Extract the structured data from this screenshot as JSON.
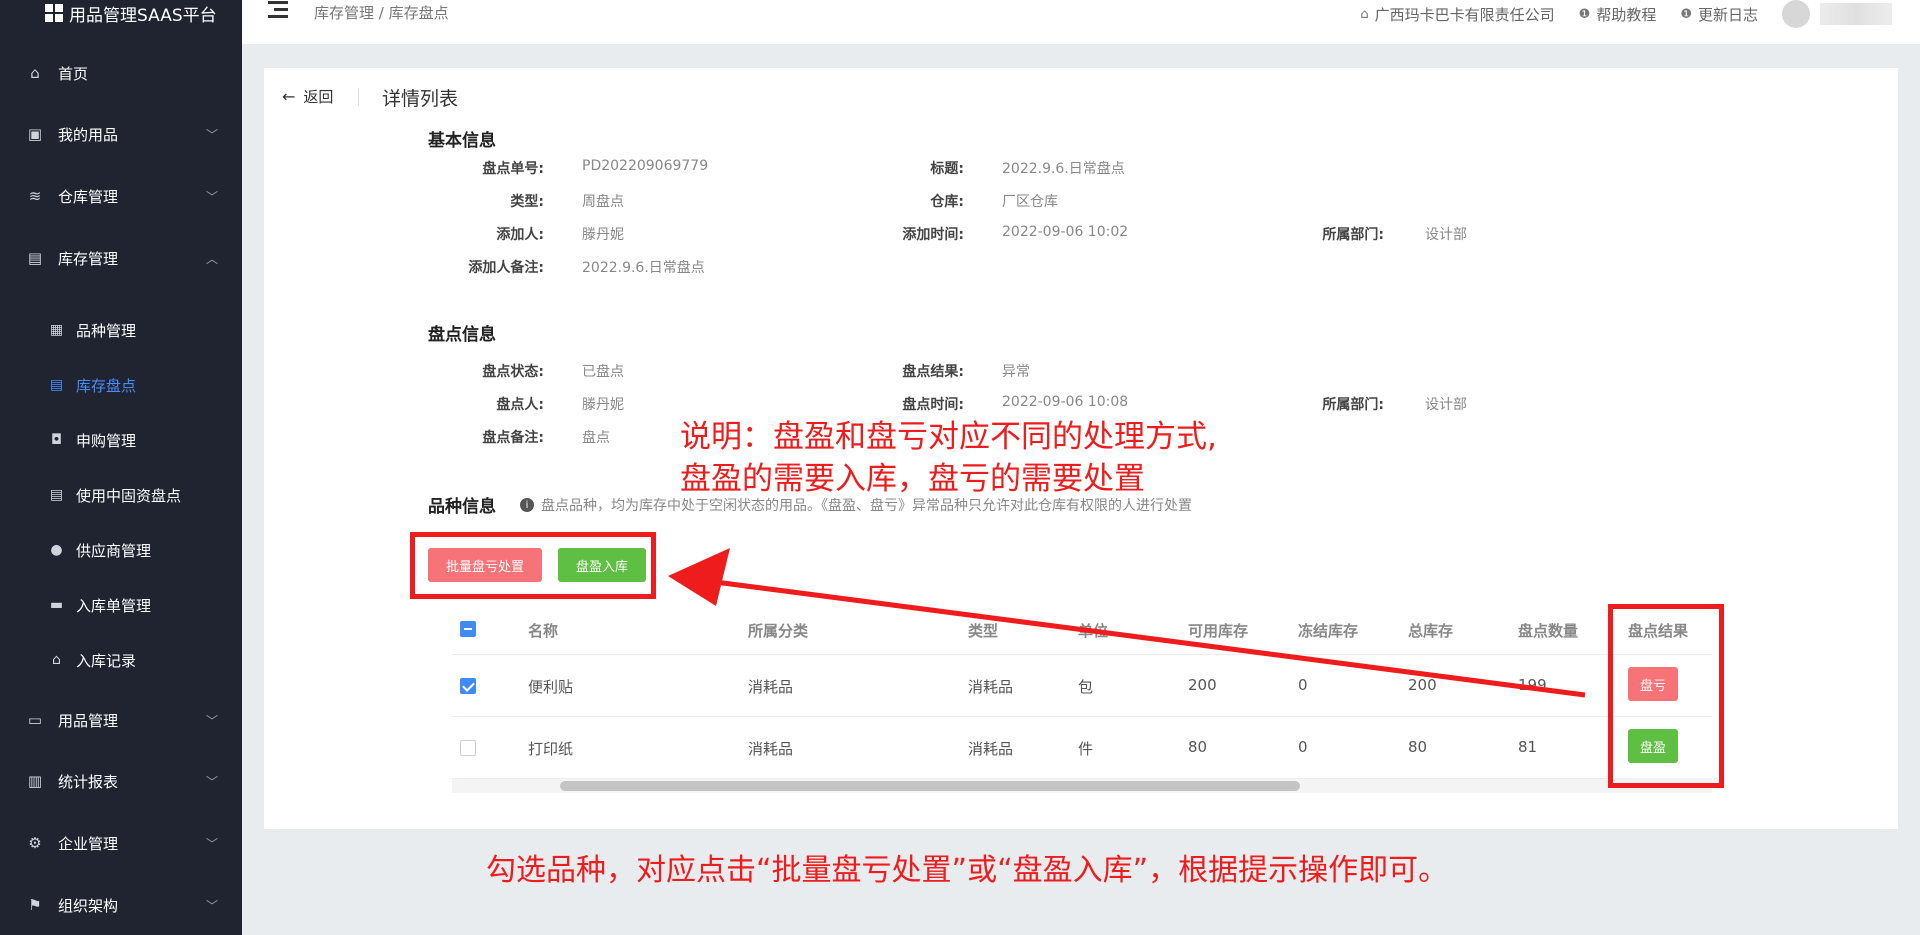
{
  "app": {
    "title": "用品管理SAAS平台"
  },
  "sidebar": {
    "items": [
      {
        "label": "首页",
        "icon": "home-icon"
      },
      {
        "label": "我的用品",
        "icon": "package-icon",
        "chevron": "down"
      },
      {
        "label": "仓库管理",
        "icon": "database-icon",
        "chevron": "down"
      },
      {
        "label": "库存管理",
        "icon": "briefcase-icon",
        "chevron": "up"
      },
      {
        "label": "用品管理",
        "icon": "inbox-icon",
        "chevron": "down"
      },
      {
        "label": "统计报表",
        "icon": "bar-chart-icon",
        "chevron": "down"
      },
      {
        "label": "企业管理",
        "icon": "gear-icon",
        "chevron": "down"
      },
      {
        "label": "组织架构",
        "icon": "flag-icon",
        "chevron": "down"
      }
    ],
    "sub_items": [
      {
        "label": "品种管理",
        "icon": "grid-icon"
      },
      {
        "label": "库存盘点",
        "icon": "document-icon",
        "active": true
      },
      {
        "label": "申购管理",
        "icon": "bag-icon"
      },
      {
        "label": "使用中固资盘点",
        "icon": "document-icon"
      },
      {
        "label": "供应商管理",
        "icon": "user-icon"
      },
      {
        "label": "入库单管理",
        "icon": "tray-icon"
      },
      {
        "label": "入库记录",
        "icon": "home-icon"
      }
    ]
  },
  "header": {
    "breadcrumb": "库存管理 / 库存盘点",
    "company": "广西玛卡巴卡有限责任公司",
    "help": "帮助教程",
    "changelog": "更新日志"
  },
  "page": {
    "back_label": "返回",
    "title": "详情列表"
  },
  "basic_info": {
    "title": "基本信息",
    "order_no_label": "盘点单号:",
    "order_no": "PD202209069779",
    "subject_label": "标题:",
    "subject": "2022.9.6.日常盘点",
    "type_label": "类型:",
    "type": "周盘点",
    "warehouse_label": "仓库:",
    "warehouse": "厂区仓库",
    "adder_label": "添加人:",
    "adder": "滕丹妮",
    "add_time_label": "添加时间:",
    "add_time": "2022-09-06 10:02",
    "dept_label": "所属部门:",
    "dept": "设计部",
    "remark_label": "添加人备注:",
    "remark": "2022.9.6.日常盘点"
  },
  "check_info": {
    "title": "盘点信息",
    "status_label": "盘点状态:",
    "status": "已盘点",
    "result_label": "盘点结果:",
    "result": "异常",
    "checker_label": "盘点人:",
    "checker": "滕丹妮",
    "check_time_label": "盘点时间:",
    "check_time": "2022-09-06 10:08",
    "dept_label": "所属部门:",
    "dept": "设计部",
    "remark_label": "盘点备注:",
    "remark": "盘点"
  },
  "items_info": {
    "title": "品种信息",
    "hint": "盘点品种，均为库存中处于空闲状态的用品。《盘盈、盘亏》异常品种只允许对此仓库有权限的人进行处置",
    "batch_loss_button": "批量盘亏处置",
    "gain_in_button": "盘盈入库"
  },
  "table": {
    "headers": [
      "名称",
      "所属分类",
      "类型",
      "单位",
      "可用库存",
      "冻结库存",
      "总库存",
      "盘点数量",
      "盘点结果"
    ],
    "rows": [
      {
        "checked": true,
        "cells": [
          "便利贴",
          "消耗品",
          "消耗品",
          "包",
          "200",
          "0",
          "200",
          "199"
        ],
        "result": "盘亏",
        "result_color": "#f67478"
      },
      {
        "checked": false,
        "cells": [
          "打印纸",
          "消耗品",
          "消耗品",
          "件",
          "80",
          "0",
          "80",
          "81"
        ],
        "result": "盘盈",
        "result_color": "#5ebf43"
      }
    ]
  },
  "annotations": {
    "note_line1": "说明：盘盈和盘亏对应不同的处理方式,",
    "note_line2": "盘盈的需要入库，盘亏的需要处置",
    "bottom": "勾选品种，对应点击“批量盘亏处置”或“盘盈入库”，根据提示操作即可。",
    "color": "#ee1c1c"
  }
}
